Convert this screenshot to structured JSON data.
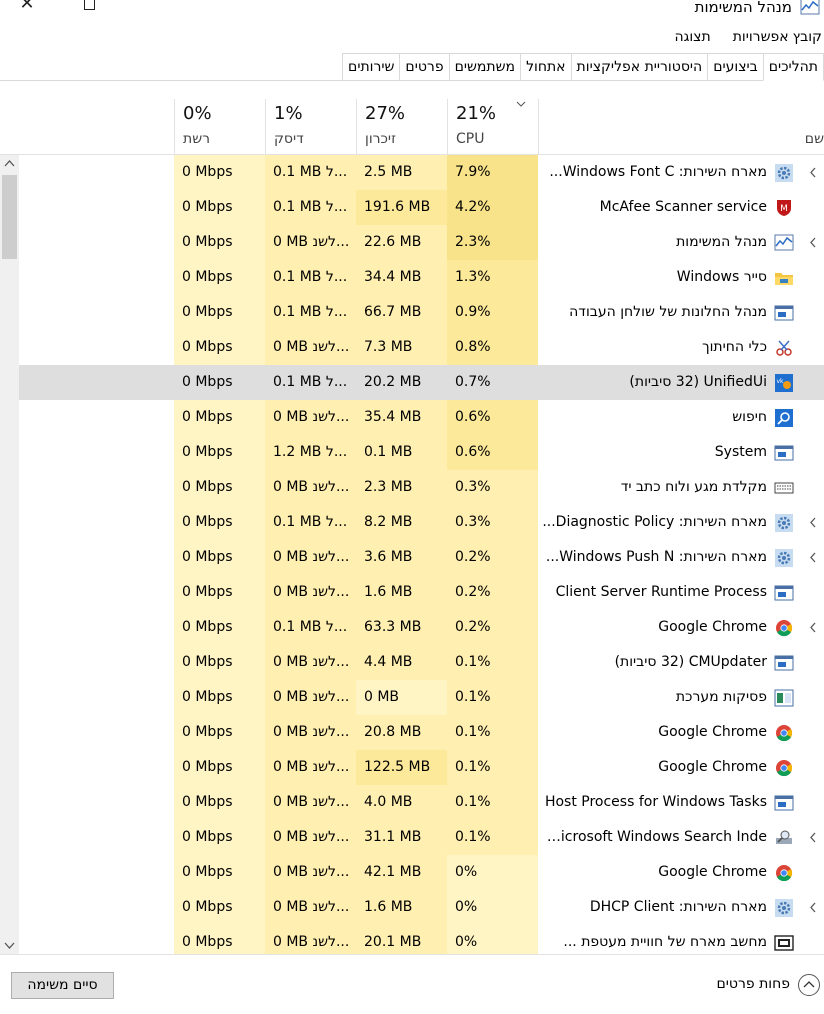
{
  "window": {
    "title": "מנהל המשימות",
    "close_glyph": "✕"
  },
  "menu": [
    "קובץ",
    "אפשרויות",
    "תצוגה"
  ],
  "tabs": [
    "תהליכים",
    "ביצועים",
    "היסטוריית אפליקציות",
    "אתחול",
    "משתמשים",
    "פרטים",
    "שירותים"
  ],
  "columns": {
    "name": "שם",
    "cpu": {
      "pct": "21%",
      "label": "CPU"
    },
    "memory": {
      "pct": "27%",
      "label": "זיכרון"
    },
    "disk": {
      "pct": "1%",
      "label": "דיסק"
    },
    "network": {
      "pct": "0%",
      "label": "רשת"
    }
  },
  "rows": [
    {
      "name": "מארח השירות: Windows Font C...",
      "cpu": "7.9%",
      "mem": "2.5 MB",
      "disk": "0.1 MB ל...",
      "net": "0 Mbps",
      "icon": "gear-icon",
      "expand": true
    },
    {
      "name": "McAfee Scanner service",
      "cpu": "4.2%",
      "mem": "191.6 MB",
      "disk": "0.1 MB ל...",
      "net": "0 Mbps",
      "icon": "mcafee-icon",
      "expand": false
    },
    {
      "name": "מנהל המשימות",
      "cpu": "2.3%",
      "mem": "22.6 MB",
      "disk": "0 MB לשנ...",
      "net": "0 Mbps",
      "icon": "task-manager-icon",
      "expand": true
    },
    {
      "name": "סייר Windows",
      "cpu": "1.3%",
      "mem": "34.4 MB",
      "disk": "0.1 MB ל...",
      "net": "0 Mbps",
      "icon": "folder-icon",
      "expand": false
    },
    {
      "name": "מנהל החלונות של שולחן העבודה",
      "cpu": "0.9%",
      "mem": "66.7 MB",
      "disk": "0.1 MB ל...",
      "net": "0 Mbps",
      "icon": "window-icon",
      "expand": false
    },
    {
      "name": "כלי החיתוך",
      "cpu": "0.8%",
      "mem": "7.3 MB",
      "disk": "0 MB לשנ...",
      "net": "0 Mbps",
      "icon": "scissors-icon",
      "expand": false
    },
    {
      "name": "UnifiedUi (32 סיביות)",
      "cpu": "0.7%",
      "mem": "20.2 MB",
      "disk": "0.1 MB ל...",
      "net": "0 Mbps",
      "icon": "unifiedui-icon",
      "expand": false,
      "selected": true
    },
    {
      "name": "חיפוש",
      "cpu": "0.6%",
      "mem": "35.4 MB",
      "disk": "0 MB לשנ...",
      "net": "0 Mbps",
      "icon": "search-icon",
      "expand": false
    },
    {
      "name": "System",
      "cpu": "0.6%",
      "mem": "0.1 MB",
      "disk": "1.2 MB ל...",
      "net": "0 Mbps",
      "icon": "window-icon",
      "expand": false
    },
    {
      "name": "מקלדת מגע ולוח כתב יד",
      "cpu": "0.3%",
      "mem": "2.3 MB",
      "disk": "0 MB לשנ...",
      "net": "0 Mbps",
      "icon": "keyboard-icon",
      "expand": false
    },
    {
      "name": "מארח השירות: Diagnostic Policy...",
      "cpu": "0.3%",
      "mem": "8.2 MB",
      "disk": "0.1 MB ל...",
      "net": "0 Mbps",
      "icon": "gear-icon",
      "expand": true
    },
    {
      "name": "מארח השירות: Windows Push N...",
      "cpu": "0.2%",
      "mem": "3.6 MB",
      "disk": "0 MB לשנ...",
      "net": "0 Mbps",
      "icon": "gear-icon",
      "expand": true
    },
    {
      "name": "Client Server Runtime Process",
      "cpu": "0.2%",
      "mem": "1.6 MB",
      "disk": "0 MB לשנ...",
      "net": "0 Mbps",
      "icon": "window-icon",
      "expand": false
    },
    {
      "name": "Google Chrome",
      "cpu": "0.2%",
      "mem": "63.3 MB",
      "disk": "0.1 MB ל...",
      "net": "0 Mbps",
      "icon": "chrome-icon",
      "expand": true
    },
    {
      "name": "CMUpdater (32 סיביות)",
      "cpu": "0.1%",
      "mem": "4.4 MB",
      "disk": "0 MB לשנ...",
      "net": "0 Mbps",
      "icon": "window-icon",
      "expand": false
    },
    {
      "name": "פסיקות מערכת",
      "cpu": "0.1%",
      "mem": "0 MB",
      "disk": "0 MB לשנ...",
      "net": "0 Mbps",
      "icon": "system-interrupts-icon",
      "expand": false
    },
    {
      "name": "Google Chrome",
      "cpu": "0.1%",
      "mem": "20.8 MB",
      "disk": "0 MB לשנ...",
      "net": "0 Mbps",
      "icon": "chrome-icon",
      "expand": false
    },
    {
      "name": "Google Chrome",
      "cpu": "0.1%",
      "mem": "122.5 MB",
      "disk": "0 MB לשנ...",
      "net": "0 Mbps",
      "icon": "chrome-icon",
      "expand": false
    },
    {
      "name": "Host Process for Windows Tasks",
      "cpu": "0.1%",
      "mem": "4.0 MB",
      "disk": "0 MB לשנ...",
      "net": "0 Mbps",
      "icon": "window-icon",
      "expand": false
    },
    {
      "name": "Microsoft Windows Search Inde...",
      "cpu": "0.1%",
      "mem": "31.1 MB",
      "disk": "0 MB לשנ...",
      "net": "0 Mbps",
      "icon": "search-indexer-icon",
      "expand": true
    },
    {
      "name": "Google Chrome",
      "cpu": "0%",
      "mem": "42.1 MB",
      "disk": "0 MB לשנ...",
      "net": "0 Mbps",
      "icon": "chrome-icon",
      "expand": false
    },
    {
      "name": "מארח השירות: DHCP Client",
      "cpu": "0%",
      "mem": "1.6 MB",
      "disk": "0 MB לשנ...",
      "net": "0 Mbps",
      "icon": "gear-icon",
      "expand": true
    },
    {
      "name": "מחשב מארח של חוויית מעטפת ...",
      "cpu": "0%",
      "mem": "20.1 MB",
      "disk": "0 MB לשנ...",
      "net": "0 Mbps",
      "icon": "shell-host-icon",
      "expand": false
    }
  ],
  "footer": {
    "fewer_details": "פחות פרטים",
    "end_task": "סיים משימה"
  }
}
